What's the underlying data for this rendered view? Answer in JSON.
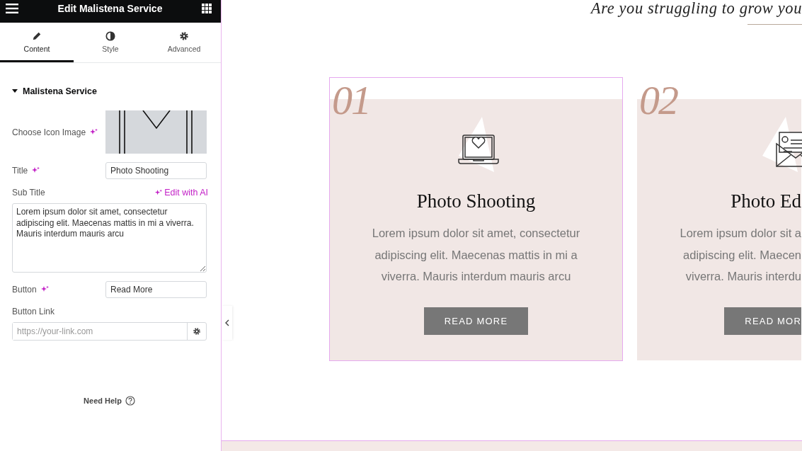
{
  "header": {
    "title": "Edit Malistena Service"
  },
  "tabs": [
    {
      "label": "Content",
      "selected": true
    },
    {
      "label": "Style",
      "selected": false
    },
    {
      "label": "Advanced",
      "selected": false
    }
  ],
  "section": {
    "title": "Malistena Service",
    "expanded": true
  },
  "fields": [
    {
      "kind": "image",
      "label": "Choose Icon Image",
      "ai": true
    },
    {
      "kind": "text",
      "label": "Title",
      "ai": true,
      "value": "Photo Shooting"
    },
    {
      "kind": "textarea",
      "label": "Sub Title",
      "ai_link": "Edit with AI",
      "value": "Lorem ipsum dolor sit amet, consectetur adipiscing elit. Maecenas mattis in mi a viverra. Mauris interdum mauris arcu"
    },
    {
      "kind": "text",
      "label": "Button",
      "ai": true,
      "value": "Read More"
    },
    {
      "kind": "url",
      "label": "Button Link",
      "placeholder": "https://your-link.com"
    }
  ],
  "help": "Need Help",
  "preview": {
    "heading": "Are you struggling to grow you",
    "cards": [
      {
        "number": "01",
        "title": "Photo Shooting",
        "lines": [
          "Lorem ipsum dolor sit amet, consectetur",
          "adipiscing elit. Maecenas mattis in mi a",
          "viverra. Mauris interdum mauris arcu"
        ],
        "button": "READ MORE",
        "selected": true
      },
      {
        "number": "02",
        "title": "Photo Ed",
        "lines": [
          "Lorem ipsum dolor sit a",
          "adipiscing elit. Maecen",
          "viverra. Mauris interdu"
        ],
        "button": "READ MOR",
        "selected": false
      }
    ]
  }
}
